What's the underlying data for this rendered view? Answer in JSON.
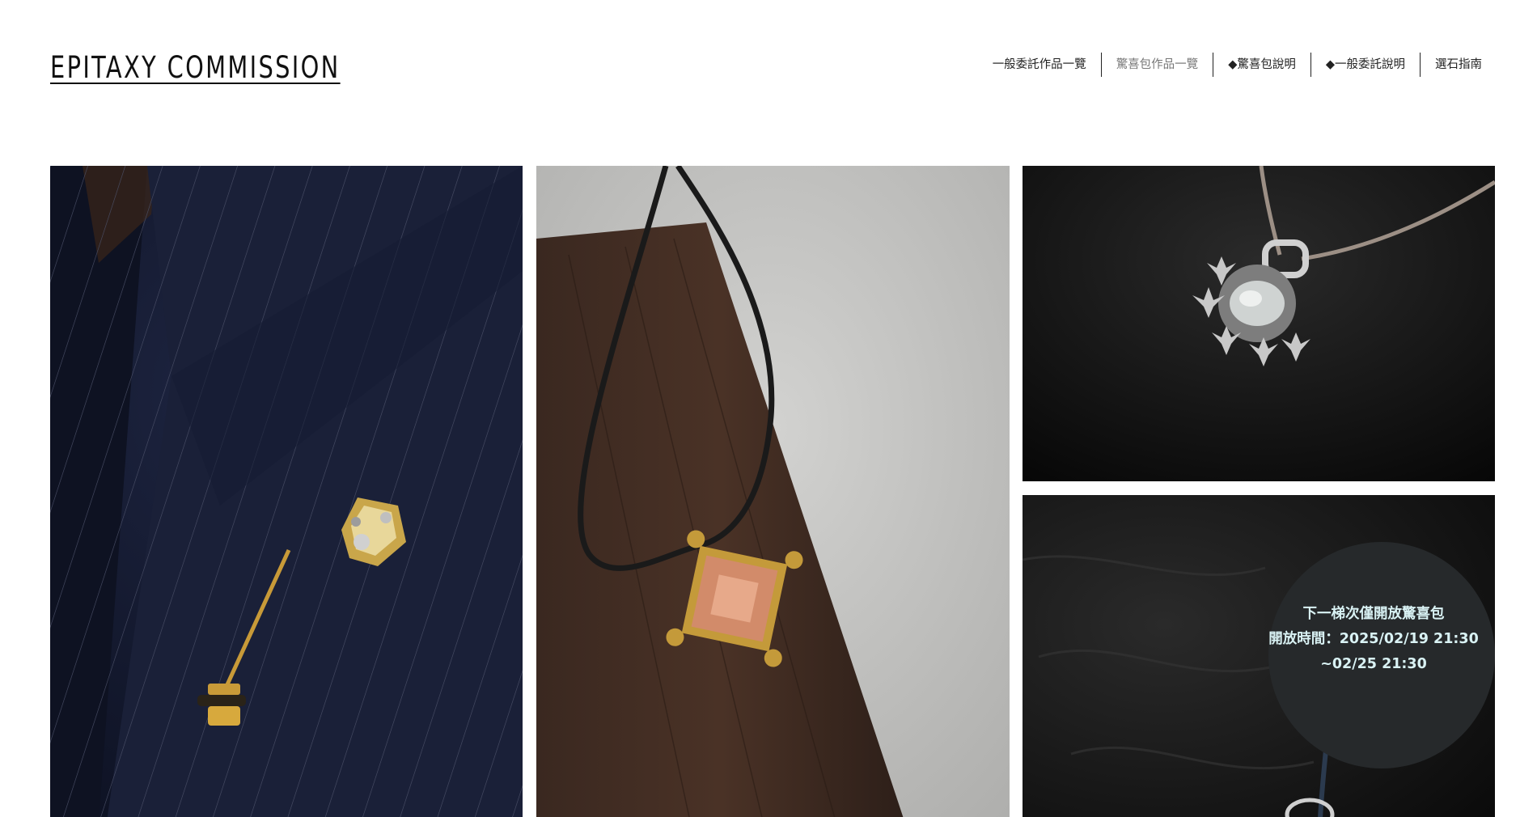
{
  "site": {
    "logo": "EPITAXY COMMISSION"
  },
  "nav": {
    "items": [
      {
        "label": "一般委託作品一覽"
      },
      {
        "label": "驚喜包作品一覽"
      },
      {
        "label": "◆驚喜包說明"
      },
      {
        "label": "◆一般委託說明"
      },
      {
        "label": "選石指南"
      }
    ]
  },
  "gallery": {
    "announcement": {
      "line1": "下一梯次僅開放驚喜包",
      "line2": "開放時間：2025/02/19 21:30",
      "line3": "~02/25 21:30"
    }
  },
  "colors": {
    "background": "#ffffff",
    "text": "#111111",
    "nav_muted": "#777777",
    "announce_bg": "#26292b",
    "announce_text": "#d9f2f4"
  }
}
